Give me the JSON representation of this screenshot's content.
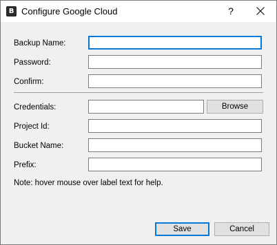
{
  "window": {
    "app_icon_letter": "B",
    "title": "Configure Google Cloud",
    "help_label": "?"
  },
  "form": {
    "backup_name": {
      "label": "Backup Name:",
      "value": ""
    },
    "password": {
      "label": "Password:",
      "value": ""
    },
    "confirm": {
      "label": "Confirm:",
      "value": ""
    },
    "credentials": {
      "label": "Credentials:",
      "value": "",
      "browse_label": "Browse"
    },
    "project_id": {
      "label": "Project Id:",
      "value": ""
    },
    "bucket_name": {
      "label": "Bucket Name:",
      "value": ""
    },
    "prefix": {
      "label": "Prefix:",
      "value": ""
    },
    "note": "Note: hover mouse over label text for help."
  },
  "footer": {
    "save_label": "Save",
    "cancel_label": "Cancel"
  },
  "colors": {
    "focus_accent": "#0078d7",
    "dialog_bg": "#f0f0f0"
  },
  "icons": [
    "app-icon",
    "help-icon",
    "close-icon"
  ]
}
